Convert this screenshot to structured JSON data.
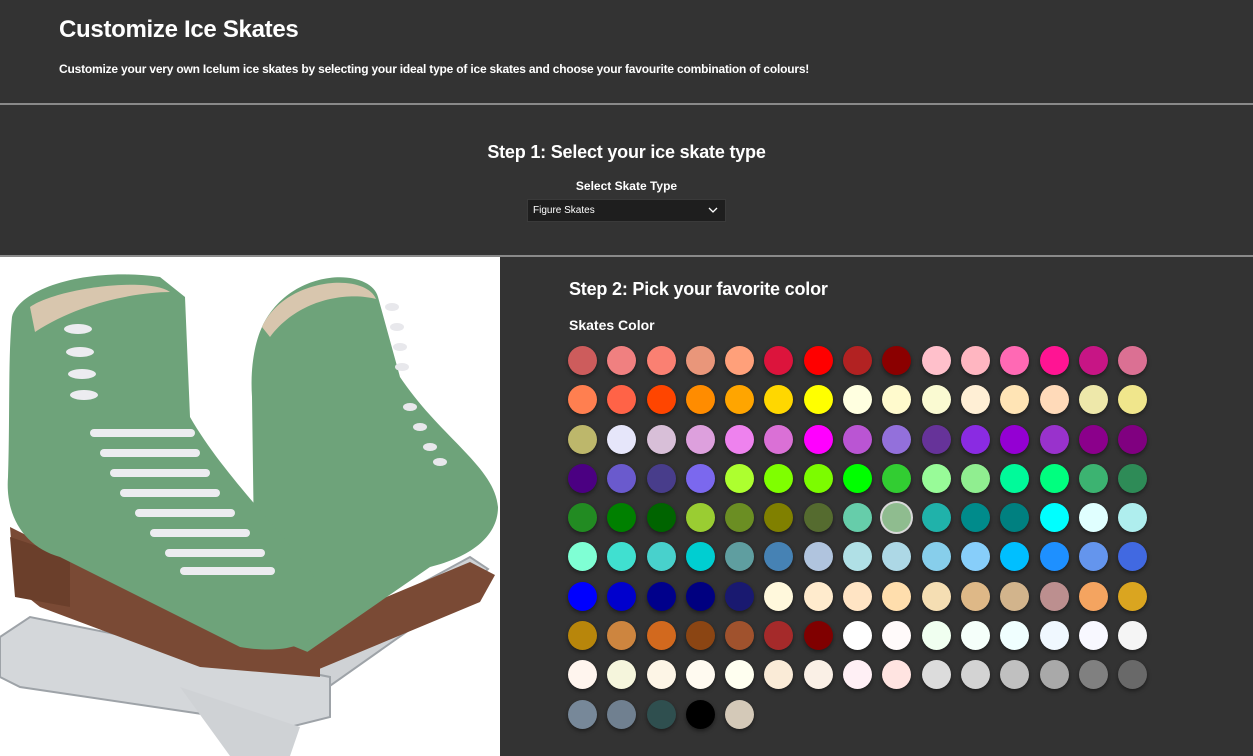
{
  "header": {
    "title": "Customize Ice Skates",
    "description": "Customize your very own Icelum ice skates by selecting your ideal type of ice skates and choose your favourite combination of colours!"
  },
  "step1": {
    "title": "Step 1: Select your ice skate type",
    "select_label": "Select Skate Type",
    "selected_value": "Figure Skates"
  },
  "step2": {
    "title": "Step 2: Pick your favorite color",
    "subtitle": "Skates Color",
    "selected_color": "#8FBC8F",
    "colors": [
      "#CD5C5C",
      "#F08080",
      "#FA8072",
      "#E9967A",
      "#FFA07A",
      "#DC143C",
      "#FF0000",
      "#B22222",
      "#8B0000",
      "#FFC0CB",
      "#FFB6C1",
      "#FF69B4",
      "#FF1493",
      "#C71585",
      "#DB7093",
      "#FF7F50",
      "#FF6347",
      "#FF4500",
      "#FF8C00",
      "#FFA500",
      "#FFD700",
      "#FFFF00",
      "#FFFFE0",
      "#FFFACD",
      "#FAFAD2",
      "#FFEFD5",
      "#FFE4B5",
      "#FFDAB9",
      "#EEE8AA",
      "#F0E68C",
      "#BDB76B",
      "#E6E6FA",
      "#D8BFD8",
      "#DDA0DD",
      "#EE82EE",
      "#DA70D6",
      "#FF00FF",
      "#BA55D3",
      "#9370DB",
      "#663399",
      "#8A2BE2",
      "#9400D3",
      "#9932CC",
      "#8B008B",
      "#800080",
      "#4B0082",
      "#6A5ACD",
      "#483D8B",
      "#7B68EE",
      "#ADFF2F",
      "#7FFF00",
      "#7CFC00",
      "#00FF00",
      "#32CD32",
      "#98FB98",
      "#90EE90",
      "#00FA9A",
      "#00FF7F",
      "#3CB371",
      "#2E8B57",
      "#228B22",
      "#008000",
      "#006400",
      "#9ACD32",
      "#6B8E23",
      "#808000",
      "#556B2F",
      "#66CDAA",
      "#8FBC8F",
      "#20B2AA",
      "#008B8B",
      "#008080",
      "#00FFFF",
      "#E0FFFF",
      "#AFEEEE",
      "#7FFFD4",
      "#40E0D0",
      "#48D1CC",
      "#00CED1",
      "#5F9EA0",
      "#4682B4",
      "#B0C4DE",
      "#B0E0E6",
      "#ADD8E6",
      "#87CEEB",
      "#87CEFA",
      "#00BFFF",
      "#1E90FF",
      "#6495ED",
      "#4169E1",
      "#0000FF",
      "#0000CD",
      "#00008B",
      "#000080",
      "#191970",
      "#FFF8DC",
      "#FFEBCD",
      "#FFE4C4",
      "#FFDEAD",
      "#F5DEB3",
      "#DEB887",
      "#D2B48C",
      "#BC8F8F",
      "#F4A460",
      "#DAA520",
      "#B8860B",
      "#CD853F",
      "#D2691E",
      "#8B4513",
      "#A0522D",
      "#A52A2A",
      "#800000",
      "#FFFFFF",
      "#FFFAFA",
      "#F0FFF0",
      "#F5FFFA",
      "#F0FFFF",
      "#F0F8FF",
      "#F8F8FF",
      "#F5F5F5",
      "#FFF5EE",
      "#F5F5DC",
      "#FDF5E6",
      "#FFFAF0",
      "#FFFFF0",
      "#FAEBD7",
      "#FAF0E6",
      "#FFF0F5",
      "#FFE4E1",
      "#DCDCDC",
      "#D3D3D3",
      "#C0C0C0",
      "#A9A9A9",
      "#808080",
      "#696969",
      "#778899",
      "#708090",
      "#2F4F4F",
      "#000000",
      "#D4C9B8"
    ]
  }
}
